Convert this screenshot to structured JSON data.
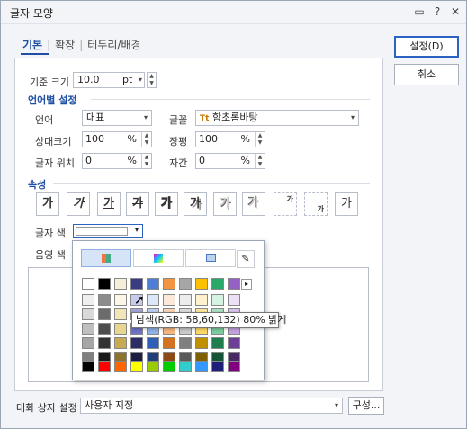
{
  "window": {
    "title": "글자 모양"
  },
  "titlebar": {
    "help_icon": "question-icon",
    "close_icon": "close-icon",
    "chat_icon": "speech-icon",
    "help_glyph": "?",
    "close_glyph": "✕",
    "chat_glyph": "▭"
  },
  "tabs": [
    {
      "label": "기본"
    },
    {
      "label": "확장"
    },
    {
      "label": "테두리/배경"
    }
  ],
  "tab_separator": "|",
  "basic": {
    "size_label": "기준 크기",
    "size_value": "10.0",
    "size_unit": "pt",
    "lang_section": "언어별 설정",
    "lang_label": "언어",
    "lang_value": "대표",
    "font_label": "글꼴",
    "font_value": "함초롬바탕",
    "font_icon": "Tt",
    "rel_size_label": "상대크기",
    "rel_size_value": "100",
    "width_label": "장평",
    "width_value": "100",
    "pos_label": "글자 위치",
    "pos_value": "0",
    "spacing_label": "자간",
    "spacing_value": "0",
    "percent": "%",
    "attr_section": "속성",
    "text_color_label": "글자 색",
    "shade_color_label": "음영 색"
  },
  "attributes": [
    {
      "name": "bold-button",
      "glyph": "가"
    },
    {
      "name": "italic-button",
      "glyph": "가"
    },
    {
      "name": "underline-button",
      "glyph": "가"
    },
    {
      "name": "strikethrough-button",
      "glyph": "가"
    },
    {
      "name": "outline-button",
      "glyph": "가"
    },
    {
      "name": "shadow-button",
      "glyph": "가"
    },
    {
      "name": "emboss-button",
      "glyph": "가"
    },
    {
      "name": "engrave-button",
      "glyph": "가"
    },
    {
      "name": "superscript-button",
      "glyph": "가"
    },
    {
      "name": "subscript-button",
      "glyph": "가"
    },
    {
      "name": "normal-button",
      "glyph": "가"
    }
  ],
  "buttons": {
    "ok": "설정(D)",
    "cancel": "취소",
    "configure": "구성..."
  },
  "footer": {
    "label": "대화 상자 설정",
    "value": "사용자 지정"
  },
  "picker": {
    "tooltip": "남색(RGB: 58,60,132) 80% 밝게",
    "more_arrow": "▸",
    "eyedropper_glyph": "✎",
    "top_row": [
      "#ffffff",
      "#000000",
      "#f6efd8",
      "#3a3c84",
      "#4f7ed6",
      "#f39443",
      "#a6a6a6",
      "#ffc000",
      "#2aa86a",
      "#9460c4"
    ],
    "shade_rows": [
      [
        "#efefef",
        "#8c8c8c",
        "#fbf6e6",
        "#c9cbec",
        "#dce7f8",
        "#fde9d9",
        "#ededed",
        "#fff2cc",
        "#d5f2e2",
        "#ece0f6"
      ],
      [
        "#d9d9d9",
        "#6b6b6b",
        "#f2e6b8",
        "#a0a3d8",
        "#b9cff1",
        "#fbd4b4",
        "#dbdbdb",
        "#ffe699",
        "#acdfc3",
        "#d8c1ec"
      ],
      [
        "#bfbfbf",
        "#4d4d4d",
        "#e8d690",
        "#6e72c4",
        "#8fb2e9",
        "#f7b680",
        "#c9c9c9",
        "#ffd966",
        "#7ccd9f",
        "#c4a2e3"
      ],
      [
        "#a6a6a6",
        "#333333",
        "#c8aa52",
        "#2b2d64",
        "#2f5fb8",
        "#d3721f",
        "#7f7f7f",
        "#bf9000",
        "#1e7e50",
        "#6d3f98"
      ],
      [
        "#808080",
        "#1a1a1a",
        "#8c742e",
        "#1c1e43",
        "#1f3f7b",
        "#8c4b14",
        "#595959",
        "#7f6000",
        "#145436",
        "#492a65"
      ]
    ],
    "bottom_row": [
      "#000000",
      "#ff0000",
      "#ff6600",
      "#ffff00",
      "#99cc00",
      "#00cc00",
      "#33cccc",
      "#3399ff",
      "#1f1f7a",
      "#800080"
    ]
  }
}
